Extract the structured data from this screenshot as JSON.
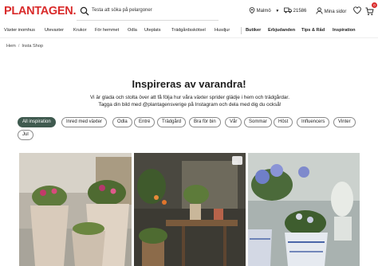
{
  "header": {
    "logo": "PLANTAGEN.",
    "search_placeholder": "Testa att söka på pelargoner",
    "store": "Malmö",
    "delivery": "21586",
    "account": "Mina sidor",
    "cart_count": "0",
    "brand_color": "#d92b2b"
  },
  "nav": {
    "items": [
      "Växter inomhus",
      "Utevaxter",
      "Krukor",
      "För hemmet",
      "Odla",
      "Uteplats",
      "Trädgårdsskötsel",
      "Husdjur"
    ],
    "bold_items": [
      "Butiker",
      "Erbjudanden",
      "Tips & Råd",
      "Inspiration"
    ]
  },
  "breadcrumb": {
    "home": "Hem",
    "current": "Insta Shop"
  },
  "main": {
    "title": "Inspireras av varandra!",
    "subtitle": "Vi är glada och stolta över att få följa hur våra växter sprider glädje i hem och trädgårdar. Tagga din bild med @plantagensverige på Instagram och dela med dig du också!"
  },
  "filters": {
    "chips": [
      "All inspiration",
      "Inred med växter",
      "Odla",
      "Entré",
      "Trädgård",
      "Bra för bin",
      "Vår",
      "Sommar",
      "Höst",
      "Influencers",
      "Vinter",
      "Jul"
    ],
    "active": "All inspiration",
    "active_color": "#3f5a4f"
  },
  "gallery": {
    "photos": [
      "photo-planters-patio",
      "photo-plant-table",
      "photo-hydrangea-pots"
    ]
  }
}
